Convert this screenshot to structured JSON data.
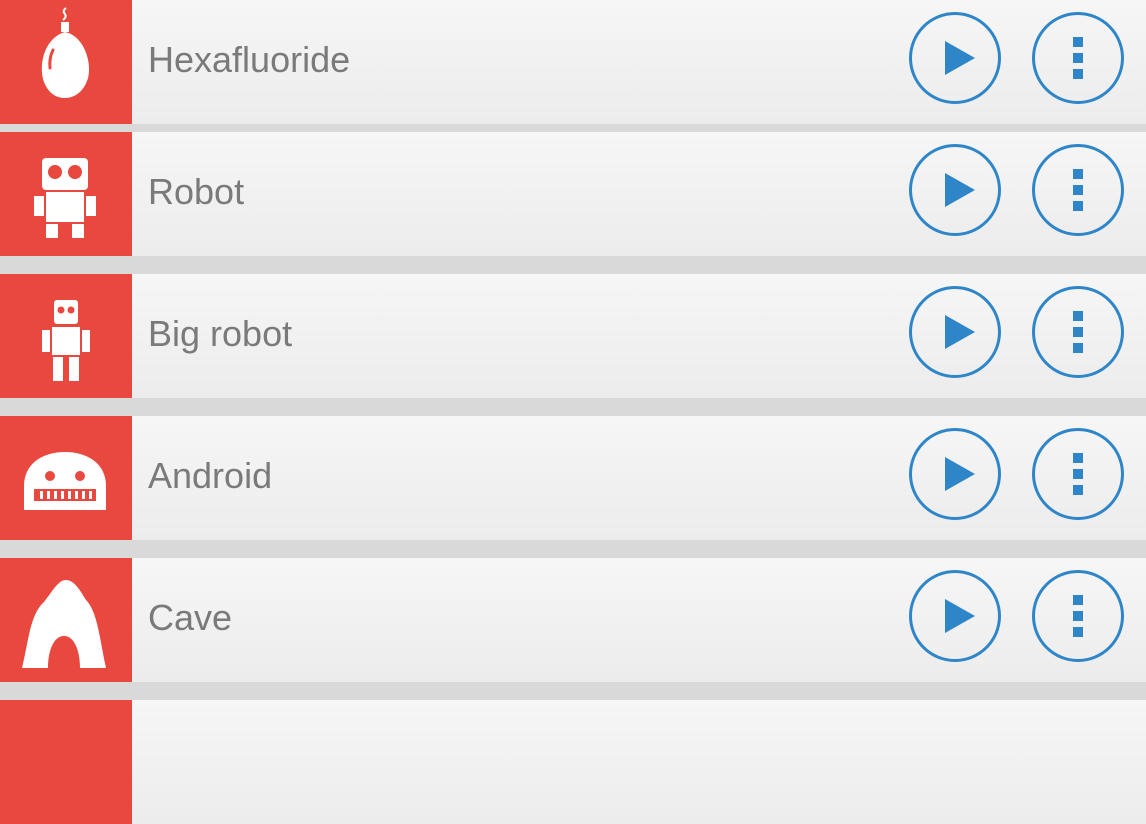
{
  "sounds": [
    {
      "title": "Hexafluoride",
      "icon": "balloon-icon"
    },
    {
      "title": "Robot",
      "icon": "robot-icon"
    },
    {
      "title": "Big robot",
      "icon": "big-robot-icon"
    },
    {
      "title": "Android",
      "icon": "android-face-icon"
    },
    {
      "title": "Cave",
      "icon": "cave-icon"
    },
    {
      "title": "",
      "icon": ""
    }
  ],
  "colors": {
    "accent_red": "#e8483d",
    "accent_blue": "#2e86c8",
    "text_gray": "#7a7a7a"
  }
}
